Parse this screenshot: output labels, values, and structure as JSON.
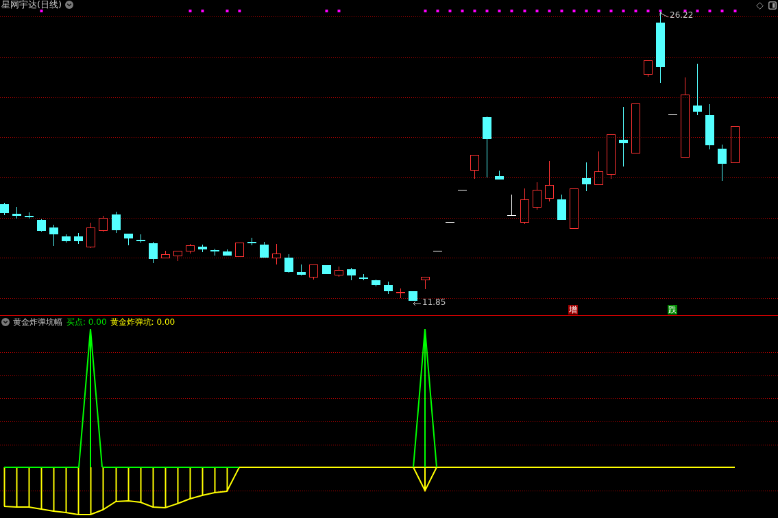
{
  "chart_header": {
    "title": "星网宇达(日线)"
  },
  "price_panel": {
    "high_label": "26.22",
    "low_label": "11.85",
    "signals": [
      {
        "label": "增",
        "color": "#a00000"
      },
      {
        "label": "跌",
        "color": "#008a00"
      }
    ]
  },
  "indicator_panel": {
    "name": "黄金炸弹坑幅",
    "readings": [
      {
        "text": "买点: 0.00",
        "color": "#00e000"
      },
      {
        "text": "黄金炸弹坑: 0.00",
        "color": "#ffff00"
      }
    ]
  }
}
